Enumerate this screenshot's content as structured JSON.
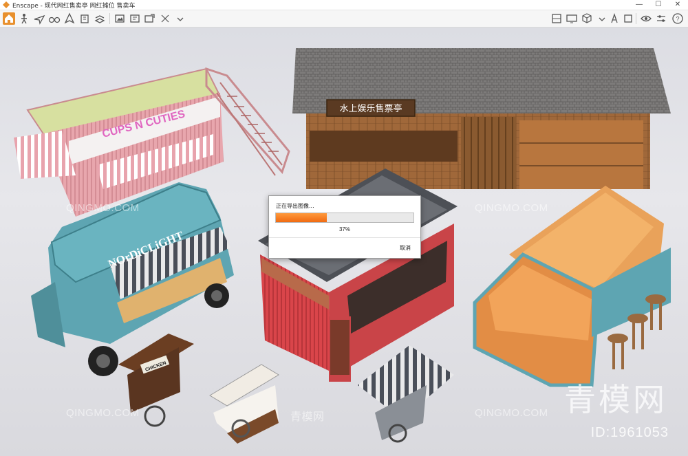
{
  "window": {
    "title": "Enscape - 现代网红售卖亭 网红摊位 售卖车",
    "controls": [
      "—",
      "☐",
      "✕"
    ]
  },
  "viewport": {
    "scene_text": {
      "sign_cups": "CUPS N CUTIES",
      "sign_ticket": "水上娱乐售票亭",
      "sign_bus": "NOrDiCLiGHT",
      "sign_chicken": "CHICKEN"
    },
    "watermarks": {
      "site": "QINGMO.COM",
      "cn": "青模网",
      "big": "青模网",
      "id": "ID:1961053"
    }
  },
  "export_dialog": {
    "title": "正在导出图像...",
    "progress": 0.37,
    "percent_label": "37%",
    "cancel_label": "取消"
  },
  "colors": {
    "accent": "#f06a12",
    "home_button": "#e8902d"
  }
}
